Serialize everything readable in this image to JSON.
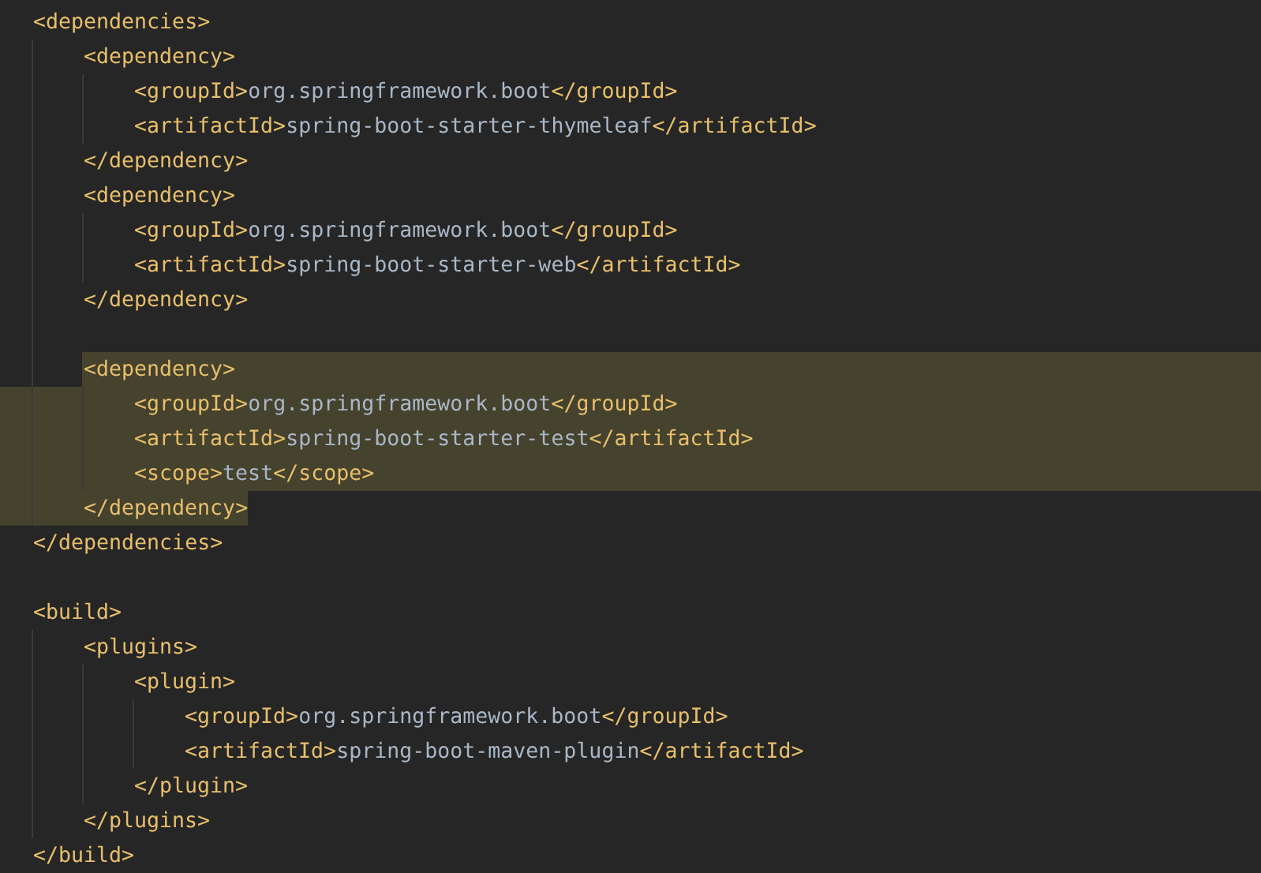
{
  "code_lines": [
    {
      "kind": "code",
      "selected": false,
      "tokens": [
        {
          "kind": "tag",
          "text": "<dependencies>"
        }
      ],
      "children": [
        {
          "kind": "code",
          "selected": false,
          "tokens": [
            {
              "kind": "tag",
              "text": "<dependency>"
            }
          ],
          "children": [
            {
              "kind": "code",
              "selected": false,
              "tokens": [
                {
                  "kind": "tag",
                  "text": "<groupId>"
                },
                {
                  "kind": "value",
                  "text": "org.springframework.boot"
                },
                {
                  "kind": "tag",
                  "text": "</groupId>"
                }
              ]
            },
            {
              "kind": "code",
              "selected": false,
              "tokens": [
                {
                  "kind": "tag",
                  "text": "<artifactId>"
                },
                {
                  "kind": "value",
                  "text": "spring-boot-starter-thymeleaf"
                },
                {
                  "kind": "tag",
                  "text": "</artifactId>"
                }
              ]
            }
          ]
        },
        {
          "kind": "code",
          "selected": false,
          "tokens": [
            {
              "kind": "tag",
              "text": "</dependency>"
            }
          ]
        },
        {
          "kind": "code",
          "selected": false,
          "tokens": [
            {
              "kind": "tag",
              "text": "<dependency>"
            }
          ],
          "children": [
            {
              "kind": "code",
              "selected": false,
              "tokens": [
                {
                  "kind": "tag",
                  "text": "<groupId>"
                },
                {
                  "kind": "value",
                  "text": "org.springframework.boot"
                },
                {
                  "kind": "tag",
                  "text": "</groupId>"
                }
              ]
            },
            {
              "kind": "code",
              "selected": false,
              "tokens": [
                {
                  "kind": "tag",
                  "text": "<artifactId>"
                },
                {
                  "kind": "value",
                  "text": "spring-boot-starter-web"
                },
                {
                  "kind": "tag",
                  "text": "</artifactId>"
                }
              ]
            }
          ]
        },
        {
          "kind": "code",
          "selected": false,
          "tokens": [
            {
              "kind": "tag",
              "text": "</dependency>"
            }
          ]
        },
        {
          "kind": "blank"
        },
        {
          "kind": "code",
          "selected": true,
          "tokens": [
            {
              "kind": "tag",
              "text": "<dependency>"
            }
          ],
          "children": [
            {
              "kind": "code",
              "selected": true,
              "tokens": [
                {
                  "kind": "tag",
                  "text": "<groupId>"
                },
                {
                  "kind": "value",
                  "text": "org.springframework.boot"
                },
                {
                  "kind": "tag",
                  "text": "</groupId>"
                }
              ]
            },
            {
              "kind": "code",
              "selected": true,
              "tokens": [
                {
                  "kind": "tag",
                  "text": "<artifactId>"
                },
                {
                  "kind": "value",
                  "text": "spring-boot-starter-test"
                },
                {
                  "kind": "tag",
                  "text": "</artifactId>"
                }
              ]
            },
            {
              "kind": "code",
              "selected": true,
              "tokens": [
                {
                  "kind": "tag",
                  "text": "<scope>"
                },
                {
                  "kind": "value",
                  "text": "test"
                },
                {
                  "kind": "tag",
                  "text": "</scope>"
                }
              ]
            }
          ]
        },
        {
          "kind": "code",
          "selected": true,
          "tokens": [
            {
              "kind": "tag",
              "text": "</dependency>"
            }
          ]
        }
      ]
    },
    {
      "kind": "code",
      "selected": false,
      "tokens": [
        {
          "kind": "tag",
          "text": "</dependencies>"
        }
      ]
    },
    {
      "kind": "blank"
    },
    {
      "kind": "code",
      "selected": false,
      "tokens": [
        {
          "kind": "tag",
          "text": "<build>"
        }
      ],
      "children": [
        {
          "kind": "code",
          "selected": false,
          "tokens": [
            {
              "kind": "tag",
              "text": "<plugins>"
            }
          ],
          "children": [
            {
              "kind": "code",
              "selected": false,
              "tokens": [
                {
                  "kind": "tag",
                  "text": "<plugin>"
                }
              ],
              "children": [
                {
                  "kind": "code",
                  "selected": false,
                  "tokens": [
                    {
                      "kind": "tag",
                      "text": "<groupId>"
                    },
                    {
                      "kind": "value",
                      "text": "org.springframework.boot"
                    },
                    {
                      "kind": "tag",
                      "text": "</groupId>"
                    }
                  ]
                },
                {
                  "kind": "code",
                  "selected": false,
                  "tokens": [
                    {
                      "kind": "tag",
                      "text": "<artifactId>"
                    },
                    {
                      "kind": "value",
                      "text": "spring-boot-maven-plugin"
                    },
                    {
                      "kind": "tag",
                      "text": "</artifactId>"
                    }
                  ]
                }
              ]
            },
            {
              "kind": "code",
              "selected": false,
              "tokens": [
                {
                  "kind": "tag",
                  "text": "</plugin>"
                }
              ]
            }
          ]
        },
        {
          "kind": "code",
          "selected": false,
          "tokens": [
            {
              "kind": "tag",
              "text": "</plugins>"
            }
          ]
        }
      ]
    },
    {
      "kind": "code",
      "selected": false,
      "tokens": [
        {
          "kind": "tag",
          "text": "</build>"
        }
      ]
    }
  ]
}
